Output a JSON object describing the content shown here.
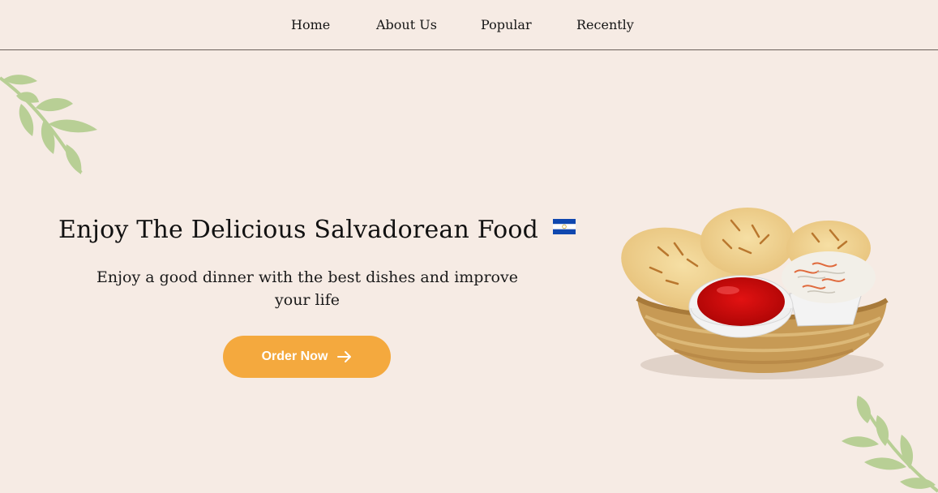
{
  "nav": {
    "items": [
      {
        "label": "Home"
      },
      {
        "label": "About Us"
      },
      {
        "label": "Popular"
      },
      {
        "label": "Recently"
      }
    ]
  },
  "hero": {
    "title": "Enjoy The Delicious Salvadorean Food",
    "flag_icon": "el-salvador-flag-icon",
    "subtitle": "Enjoy a good dinner with the best dishes and improve your life",
    "cta_label": "Order Now",
    "cta_icon": "arrow-right-icon"
  },
  "colors": {
    "background": "#f6ebe4",
    "accent": "#f4a93e",
    "leaf": "#b8cf95",
    "flag_blue": "#0f47af",
    "sauce_red": "#d80f0f"
  }
}
